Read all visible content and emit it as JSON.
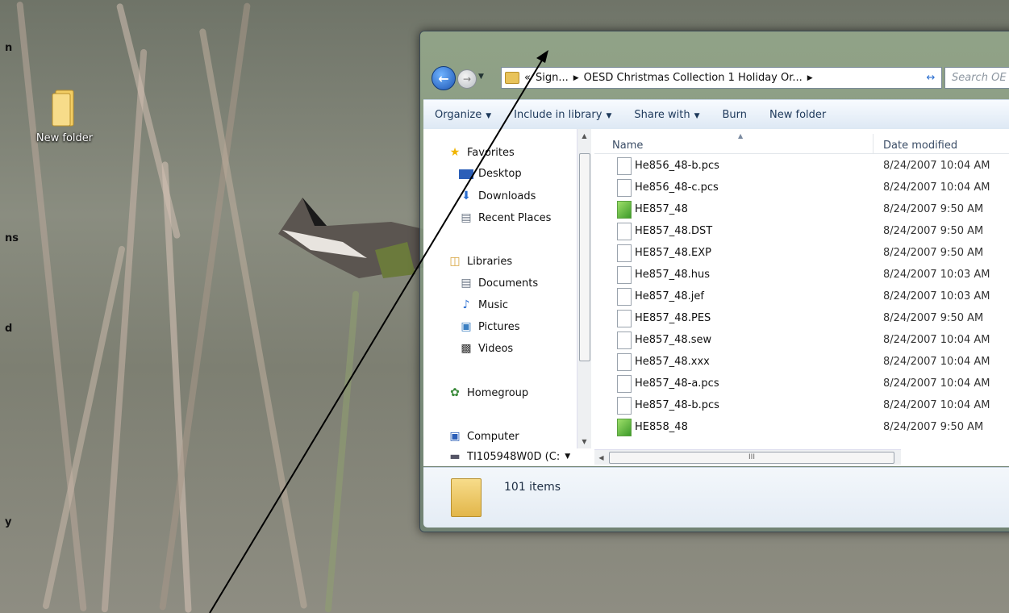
{
  "desktop": {
    "icon_label": "New folder",
    "edge_fragments": [
      "n",
      "ns",
      "d",
      "y"
    ]
  },
  "explorer": {
    "address": {
      "crumbs": [
        "Sign...",
        "OESD Christmas Collection 1 Holiday Or..."
      ],
      "search_placeholder": "Search OE"
    },
    "toolbar": [
      {
        "label": "Organize",
        "dropdown": true
      },
      {
        "label": "Include in library",
        "dropdown": true
      },
      {
        "label": "Share with",
        "dropdown": true
      },
      {
        "label": "Burn",
        "dropdown": false
      },
      {
        "label": "New folder",
        "dropdown": false
      }
    ],
    "nav": {
      "favorites": "Favorites",
      "desktop": "Desktop",
      "downloads": "Downloads",
      "recent": "Recent Places",
      "libraries": "Libraries",
      "documents": "Documents",
      "music": "Music",
      "pictures": "Pictures",
      "videos": "Videos",
      "homegroup": "Homegroup",
      "computer": "Computer",
      "drive": "TI105948W0D (C:"
    },
    "columns": {
      "name": "Name",
      "date": "Date modified"
    },
    "files": [
      {
        "name": "He856_48-b.pcs",
        "date": "8/24/2007 10:04 AM",
        "icon": "file"
      },
      {
        "name": "He856_48-c.pcs",
        "date": "8/24/2007 10:04 AM",
        "icon": "file"
      },
      {
        "name": "HE857_48",
        "date": "8/24/2007 9:50 AM",
        "icon": "image"
      },
      {
        "name": "HE857_48.DST",
        "date": "8/24/2007 9:50 AM",
        "icon": "file"
      },
      {
        "name": "HE857_48.EXP",
        "date": "8/24/2007 9:50 AM",
        "icon": "file"
      },
      {
        "name": "He857_48.hus",
        "date": "8/24/2007 10:03 AM",
        "icon": "file"
      },
      {
        "name": "He857_48.jef",
        "date": "8/24/2007 10:03 AM",
        "icon": "file"
      },
      {
        "name": "HE857_48.PES",
        "date": "8/24/2007 9:50 AM",
        "icon": "file"
      },
      {
        "name": "He857_48.sew",
        "date": "8/24/2007 10:04 AM",
        "icon": "file"
      },
      {
        "name": "He857_48.xxx",
        "date": "8/24/2007 10:04 AM",
        "icon": "file"
      },
      {
        "name": "He857_48-a.pcs",
        "date": "8/24/2007 10:04 AM",
        "icon": "file"
      },
      {
        "name": "He857_48-b.pcs",
        "date": "8/24/2007 10:04 AM",
        "icon": "file"
      },
      {
        "name": "HE858_48",
        "date": "8/24/2007 9:50 AM",
        "icon": "image"
      }
    ],
    "hscroll_grip": "III",
    "status": {
      "item_count": "101 items"
    }
  }
}
